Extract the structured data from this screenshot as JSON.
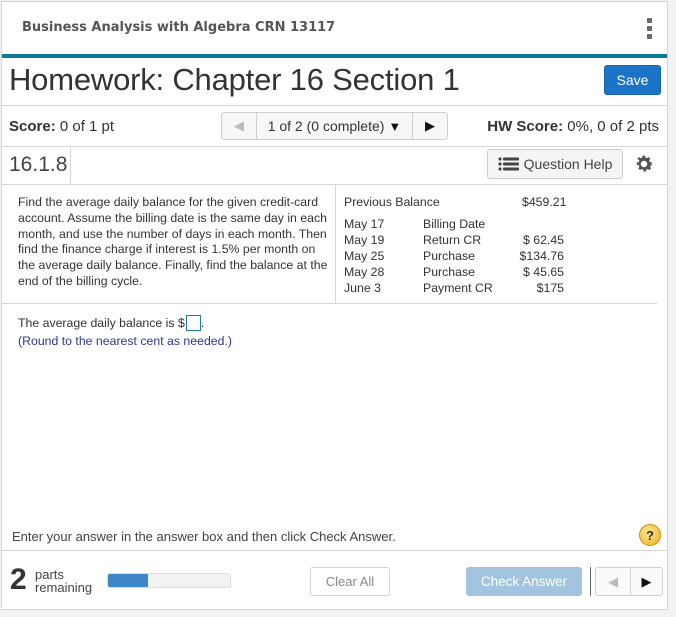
{
  "header": {
    "course_title": "Business Analysis with Algebra CRN 13117",
    "menu_icon": "kebab-vertical-icon",
    "homework_title": "Homework: Chapter 16 Section 1",
    "save_label": "Save",
    "accent_color": "#0a7a99",
    "save_color": "#1a73c6"
  },
  "score_bar": {
    "score_label": "Score:",
    "score_value": " 0 of 1 pt",
    "pager_text": "1 of 2 (0 complete)",
    "prev_glyph": "◀",
    "caret_glyph": "▼",
    "next_glyph": "▶",
    "hw_score_label": "HW Score:",
    "hw_score_value": " 0%, 0 of 2 pts"
  },
  "question_bar": {
    "question_id": "16.1.8",
    "help_label": "Question Help",
    "help_icon": "list-icon",
    "settings_icon": "gear-icon"
  },
  "question": {
    "prompt": "Find the average daily balance for the given credit-card account. Assume the billing date is the same day in each month, and use the number of days in each month. Then find the finance charge if interest is 1.5% per month on the average daily balance. Finally, find the balance at the end of the billing cycle.",
    "previous_balance_label": "Previous Balance",
    "previous_balance_value": "$459.21",
    "transactions": [
      {
        "date": "May 17",
        "type": "Billing Date",
        "amount": ""
      },
      {
        "date": "May  19",
        "type": "Return CR",
        "amount": "$ 62.45"
      },
      {
        "date": "May  25",
        "type": "Purchase",
        "amount": "$134.76"
      },
      {
        "date": "May  28",
        "type": "Purchase",
        "amount": "$ 45.65"
      },
      {
        "date": "June 3",
        "type": "Payment CR",
        "amount": "$175"
      }
    ]
  },
  "answer": {
    "prefix": "The average daily balance is $",
    "value": "",
    "suffix": ".",
    "hint": "(Round to the nearest cent as needed.)"
  },
  "footer": {
    "instruction": "Enter your answer in the answer box and then click Check Answer.",
    "help_glyph": "?",
    "parts_count": "2",
    "parts_label_1": "parts",
    "parts_label_2": "remaining",
    "progress_fraction": 0.33,
    "clear_label": "Clear All",
    "check_label": "Check Answer",
    "prev_glyph": "◀",
    "next_glyph": "▶"
  }
}
